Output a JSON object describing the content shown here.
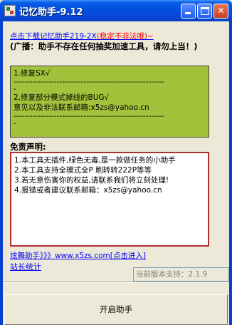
{
  "window": {
    "title": "记忆助手-9.12",
    "minimize_label": "_",
    "maximize_label": "□",
    "close_label": "X"
  },
  "download_link": {
    "prefix": "点击下载记忆助手219-2X",
    "suffix": "(稳定不非法哦)~"
  },
  "notice": "(广播：助手不存在任何抽奖加速工具，请勿上当！)",
  "update_box": {
    "line1": "1.修复SX√",
    "dash1": "--------------------------------------------------------",
    "dash2": "-",
    "line2": "2,修复部分模式掉线的BUG√",
    "line3": "意见以及非法联系邮箱:x5zs@yahoo.cn",
    "dash3": "--------------------------------------------------------",
    "dash4": "-"
  },
  "disclaimer": {
    "heading": "免责声明:",
    "items": [
      "1.本工具无插件,绿色无毒,是一款做任务的小助手",
      "2.本工具支持全模式全P 刷转转222P等等",
      "3.若无意伤害你的权益,请联系我们将立刻处理!",
      "4.报错或者建议联系邮箱：x5zs@yahoo.cn"
    ]
  },
  "links": {
    "dance": "炫舞助手》》》www.x5zs.com[点击进入]",
    "admin": "站长统计"
  },
  "version_field": "当前版本支持：2.1.9",
  "start_button": "开启助手"
}
